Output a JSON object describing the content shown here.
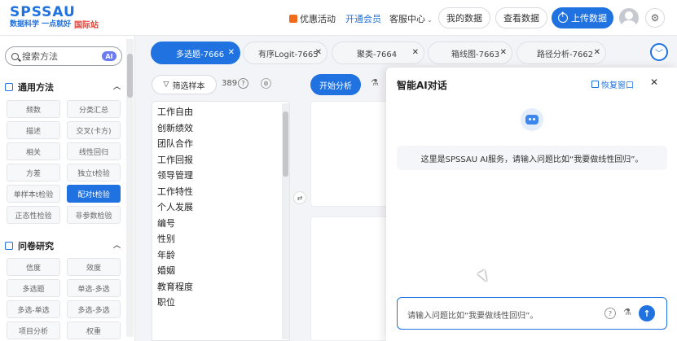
{
  "header": {
    "brand": "SPSSAU",
    "slogan": "数据科学 一点就好",
    "intl": "国际站",
    "promo": "优惠活动",
    "vip": "开通会员",
    "service": "客服中心",
    "my_data": "我的数据",
    "view_data": "查看数据",
    "upload": "上传数据"
  },
  "sidebar": {
    "search_placeholder": "搜索方法",
    "ai_badge": "AI",
    "sections": [
      {
        "title": "通用方法",
        "items": [
          "频数",
          "分类汇总",
          "描述",
          "交叉(卡方)",
          "相关",
          "线性回归",
          "方差",
          "独立t检验",
          "单样本t检验",
          "配对t检验",
          "正态性检验",
          "非参数检验"
        ]
      },
      {
        "title": "问卷研究",
        "items": [
          "信度",
          "效度",
          "多选题",
          "单选-多选",
          "多选-单选",
          "多选-多选",
          "项目分析",
          "权重"
        ]
      }
    ],
    "active_item": "配对t检验"
  },
  "tabs": [
    {
      "label": "多选题-7666",
      "active": true
    },
    {
      "label": "有序Logit-7665",
      "active": false
    },
    {
      "label": "聚类-7664",
      "active": false
    },
    {
      "label": "箱线图-7663",
      "active": false
    },
    {
      "label": "路径分析-7662",
      "active": false
    }
  ],
  "toolbar": {
    "filter_label": "筛选样本",
    "sample_count": "389",
    "start_label": "开始分析"
  },
  "variables": [
    "工作自由",
    "创新绩效",
    "团队合作",
    "工作回报",
    "领导管理",
    "工作特性",
    "个人发展",
    "编号",
    "性别",
    "年龄",
    "婚姻",
    "教育程度",
    "职位"
  ],
  "ai_chat": {
    "title": "智能AI对话",
    "restore_label": "恢复窗口",
    "welcome": "这里是SPSSAU AI服务，请输入问题比如“我要做线性回归”。",
    "input_placeholder": "请输入问题比如“我要做线性回归”。"
  }
}
